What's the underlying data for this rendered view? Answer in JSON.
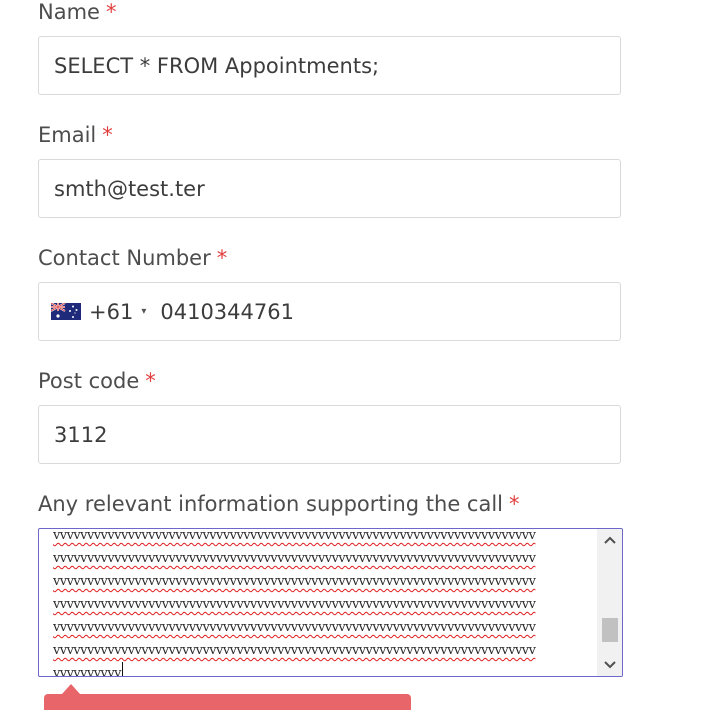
{
  "form": {
    "name": {
      "label": "Name",
      "required_mark": "*",
      "value": "SELECT * FROM Appointments;"
    },
    "email": {
      "label": "Email",
      "required_mark": "*",
      "value": "smth@test.ter"
    },
    "contact": {
      "label": "Contact Number",
      "required_mark": "*",
      "country_icon": "australia-flag-icon",
      "dial_code": "+61",
      "dropdown_caret": "▾",
      "value": "0410344761"
    },
    "postcode": {
      "label": "Post code",
      "required_mark": "*",
      "value": "3112"
    },
    "info": {
      "label": "Any relevant information supporting the call",
      "required_mark": "*",
      "lines": [
        "vvvvvvvvvvvvvvvvvvvvvvvvvvvvvvvvvvvvvvvvvvvvvvvvvvvvvvvvvvvvvvvvvvvvvvv",
        "vvvvvvvvvvvvvvvvvvvvvvvvvvvvvvvvvvvvvvvvvvvvvvvvvvvvvvvvvvvvvvvvvvvvvvv",
        "vvvvvvvvvvvvvvvvvvvvvvvvvvvvvvvvvvvvvvvvvvvvvvvvvvvvvvvvvvvvvvvvvvvvvvv",
        "vvvvvvvvvvvvvvvvvvvvvvvvvvvvvvvvvvvvvvvvvvvvvvvvvvvvvvvvvvvvvvvvvvvvvvv",
        "vvvvvvvvvvvvvvvvvvvvvvvvvvvvvvvvvvvvvvvvvvvvvvvvvvvvvvvvvvvvvvvvvvvvvvv",
        "vvvvvvvvvvvvvvvvvvvvvvvvvvvvvvvvvvvvvvvvvvvvvvvvvvvvvvvvvvvvvvvvvvvvvvv",
        "vvvvvvvvvv"
      ],
      "scroll_up_icon": "chevron-up-icon",
      "scroll_down_icon": "chevron-down-icon",
      "scroll_position": 0.85
    }
  },
  "colors": {
    "required": "#e0403f",
    "textarea_focus_border": "#6d67c9",
    "spellcheck_underline": "#e01b1b",
    "error_tooltip": "#e8666a"
  }
}
